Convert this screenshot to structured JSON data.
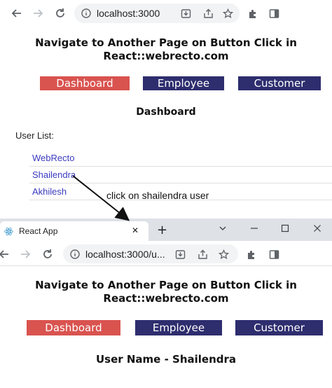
{
  "browser_top": {
    "url": "localhost:3000"
  },
  "page_top": {
    "heading_line1": "Navigate to Another Page on Button Click in",
    "heading_line2": "React::webrecto.com",
    "buttons": {
      "dashboard": "Dashboard",
      "employee": "Employee",
      "customer": "Customer"
    },
    "section_title": "Dashboard",
    "user_list_label": "User List:",
    "users": [
      "WebRecto",
      "Shailendra",
      "Akhilesh"
    ]
  },
  "annotation": {
    "text": "click on shailendra user"
  },
  "browser_bottom": {
    "tab_title": "React App",
    "tab_close": "✕",
    "new_tab": "+",
    "url": "localhost:3000/u..."
  },
  "page_bottom": {
    "heading_line1": "Navigate to Another Page on Button Click in",
    "heading_line2": "React::webrecto.com",
    "buttons": {
      "dashboard": "Dashboard",
      "employee": "Employee",
      "customer": "Customer"
    },
    "user_name": "User Name - Shailendra"
  },
  "colors": {
    "red_button": "#d9534f",
    "navy_button": "#2e2d6e",
    "link": "#3b3bbf",
    "tabstrip": "#dee1e6"
  }
}
